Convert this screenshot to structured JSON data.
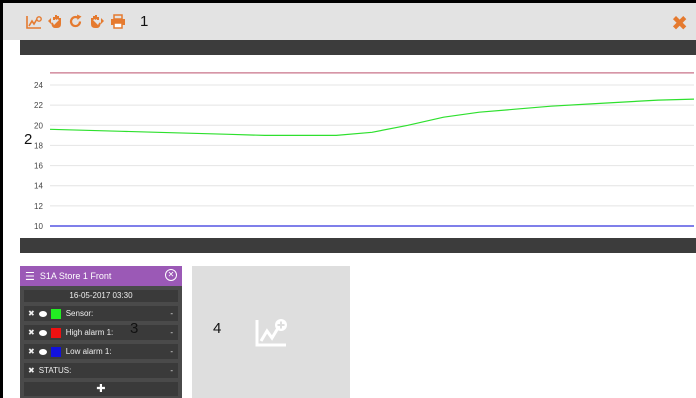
{
  "toolbar": {
    "icons": [
      "chart-zoom-icon",
      "hand-left-icon",
      "refresh-icon",
      "hand-right-icon",
      "print-icon"
    ],
    "label_1": "1",
    "close_symbol": "✖"
  },
  "chart": {
    "area_label": "2",
    "y_ticks": [
      "10",
      "12",
      "14",
      "16",
      "18",
      "20",
      "22",
      "24"
    ]
  },
  "chart_data": {
    "type": "line",
    "ylim": [
      9,
      26
    ],
    "grid": true,
    "series": [
      {
        "color": "#c9738a",
        "values": [
          25.2,
          25.2
        ]
      },
      {
        "color": "#2ee02e",
        "values": [
          19.6,
          19.5,
          19.4,
          19.3,
          19.2,
          19.1,
          19.0,
          19.0,
          19.0,
          19.3,
          20.0,
          20.8,
          21.3,
          21.6,
          21.9,
          22.1,
          22.3,
          22.5,
          22.6
        ]
      },
      {
        "color": "#3333dd",
        "values": [
          10.0,
          10.0
        ]
      }
    ]
  },
  "sensor_panel": {
    "title": "S1A Store 1 Front",
    "date": "16-05-2017 03:30",
    "area_label": "3",
    "rows": [
      {
        "label": "Sensor:",
        "value": "-",
        "color": "#22ee22"
      },
      {
        "label": "High alarm 1:",
        "value": "-",
        "color": "#ee1111"
      },
      {
        "label": "Low alarm 1:",
        "value": "-",
        "color": "#1111dd"
      }
    ],
    "status_label": "STATUS:",
    "status_value": "-",
    "add_symbol": "✚"
  },
  "add_chart_tile": {
    "area_label": "4",
    "icon": "chart-add-icon"
  }
}
